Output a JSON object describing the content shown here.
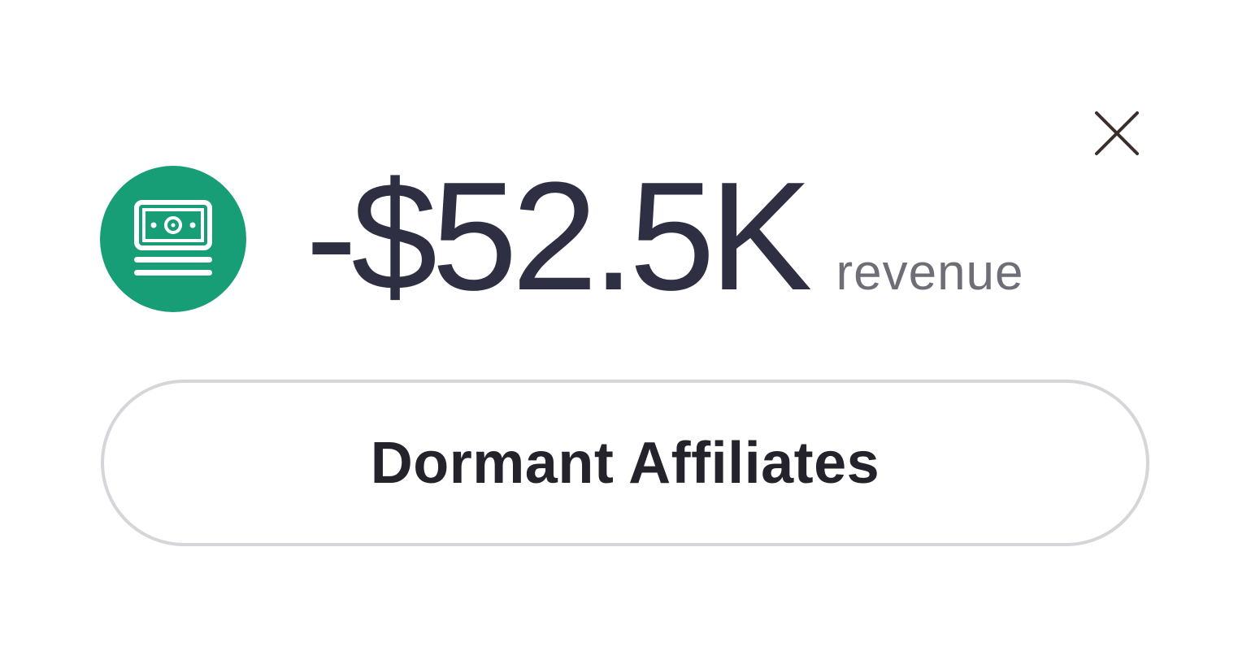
{
  "summary": {
    "amount": "-$52.5K",
    "unit": "revenue",
    "icon": "money-stack-icon",
    "icon_background": "#179e77"
  },
  "segment": {
    "label": "Dormant Affiliates"
  },
  "close": {
    "icon": "close-icon"
  },
  "colors": {
    "amount_text": "#2f2f44",
    "unit_text": "#6f6e77",
    "pill_border": "#d6d6da",
    "pill_text": "#24232c"
  }
}
